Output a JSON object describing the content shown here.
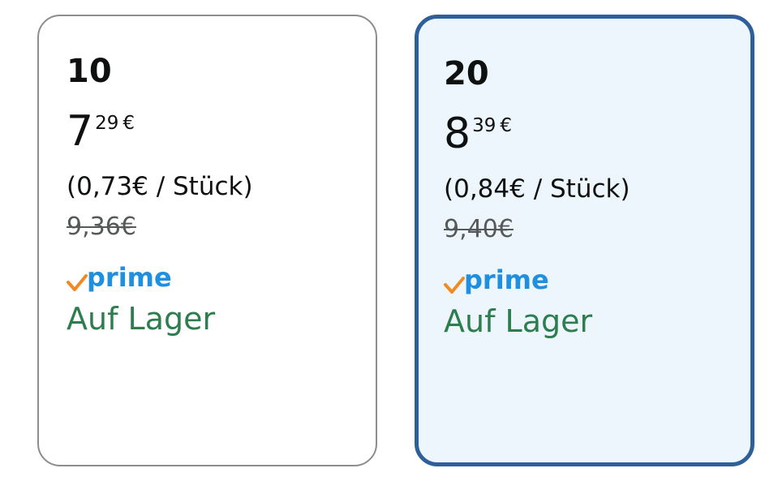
{
  "options": [
    {
      "quantity": "10",
      "price_whole": "7",
      "price_fraction": "29",
      "currency": "€",
      "unit_price": "(0,73€ / Stück)",
      "list_price": "9,36€",
      "prime_label": "prime",
      "availability": "Auf Lager",
      "selected": false
    },
    {
      "quantity": "20",
      "price_whole": "8",
      "price_fraction": "39",
      "currency": "€",
      "unit_price": "(0,84€ / Stück)",
      "list_price": "9,40€",
      "prime_label": "prime",
      "availability": "Auf Lager",
      "selected": true
    }
  ],
  "colors": {
    "selected_border": "#2f5f9b",
    "selected_background": "#edf6fd",
    "unselected_border": "#8d8d8d",
    "availability_text": "#2e7d4f",
    "prime_blue": "#1f8fe0",
    "prime_check_orange": "#f08a24",
    "list_price_text": "#565959"
  },
  "icons": {
    "prime_check": "checkmark-icon"
  }
}
